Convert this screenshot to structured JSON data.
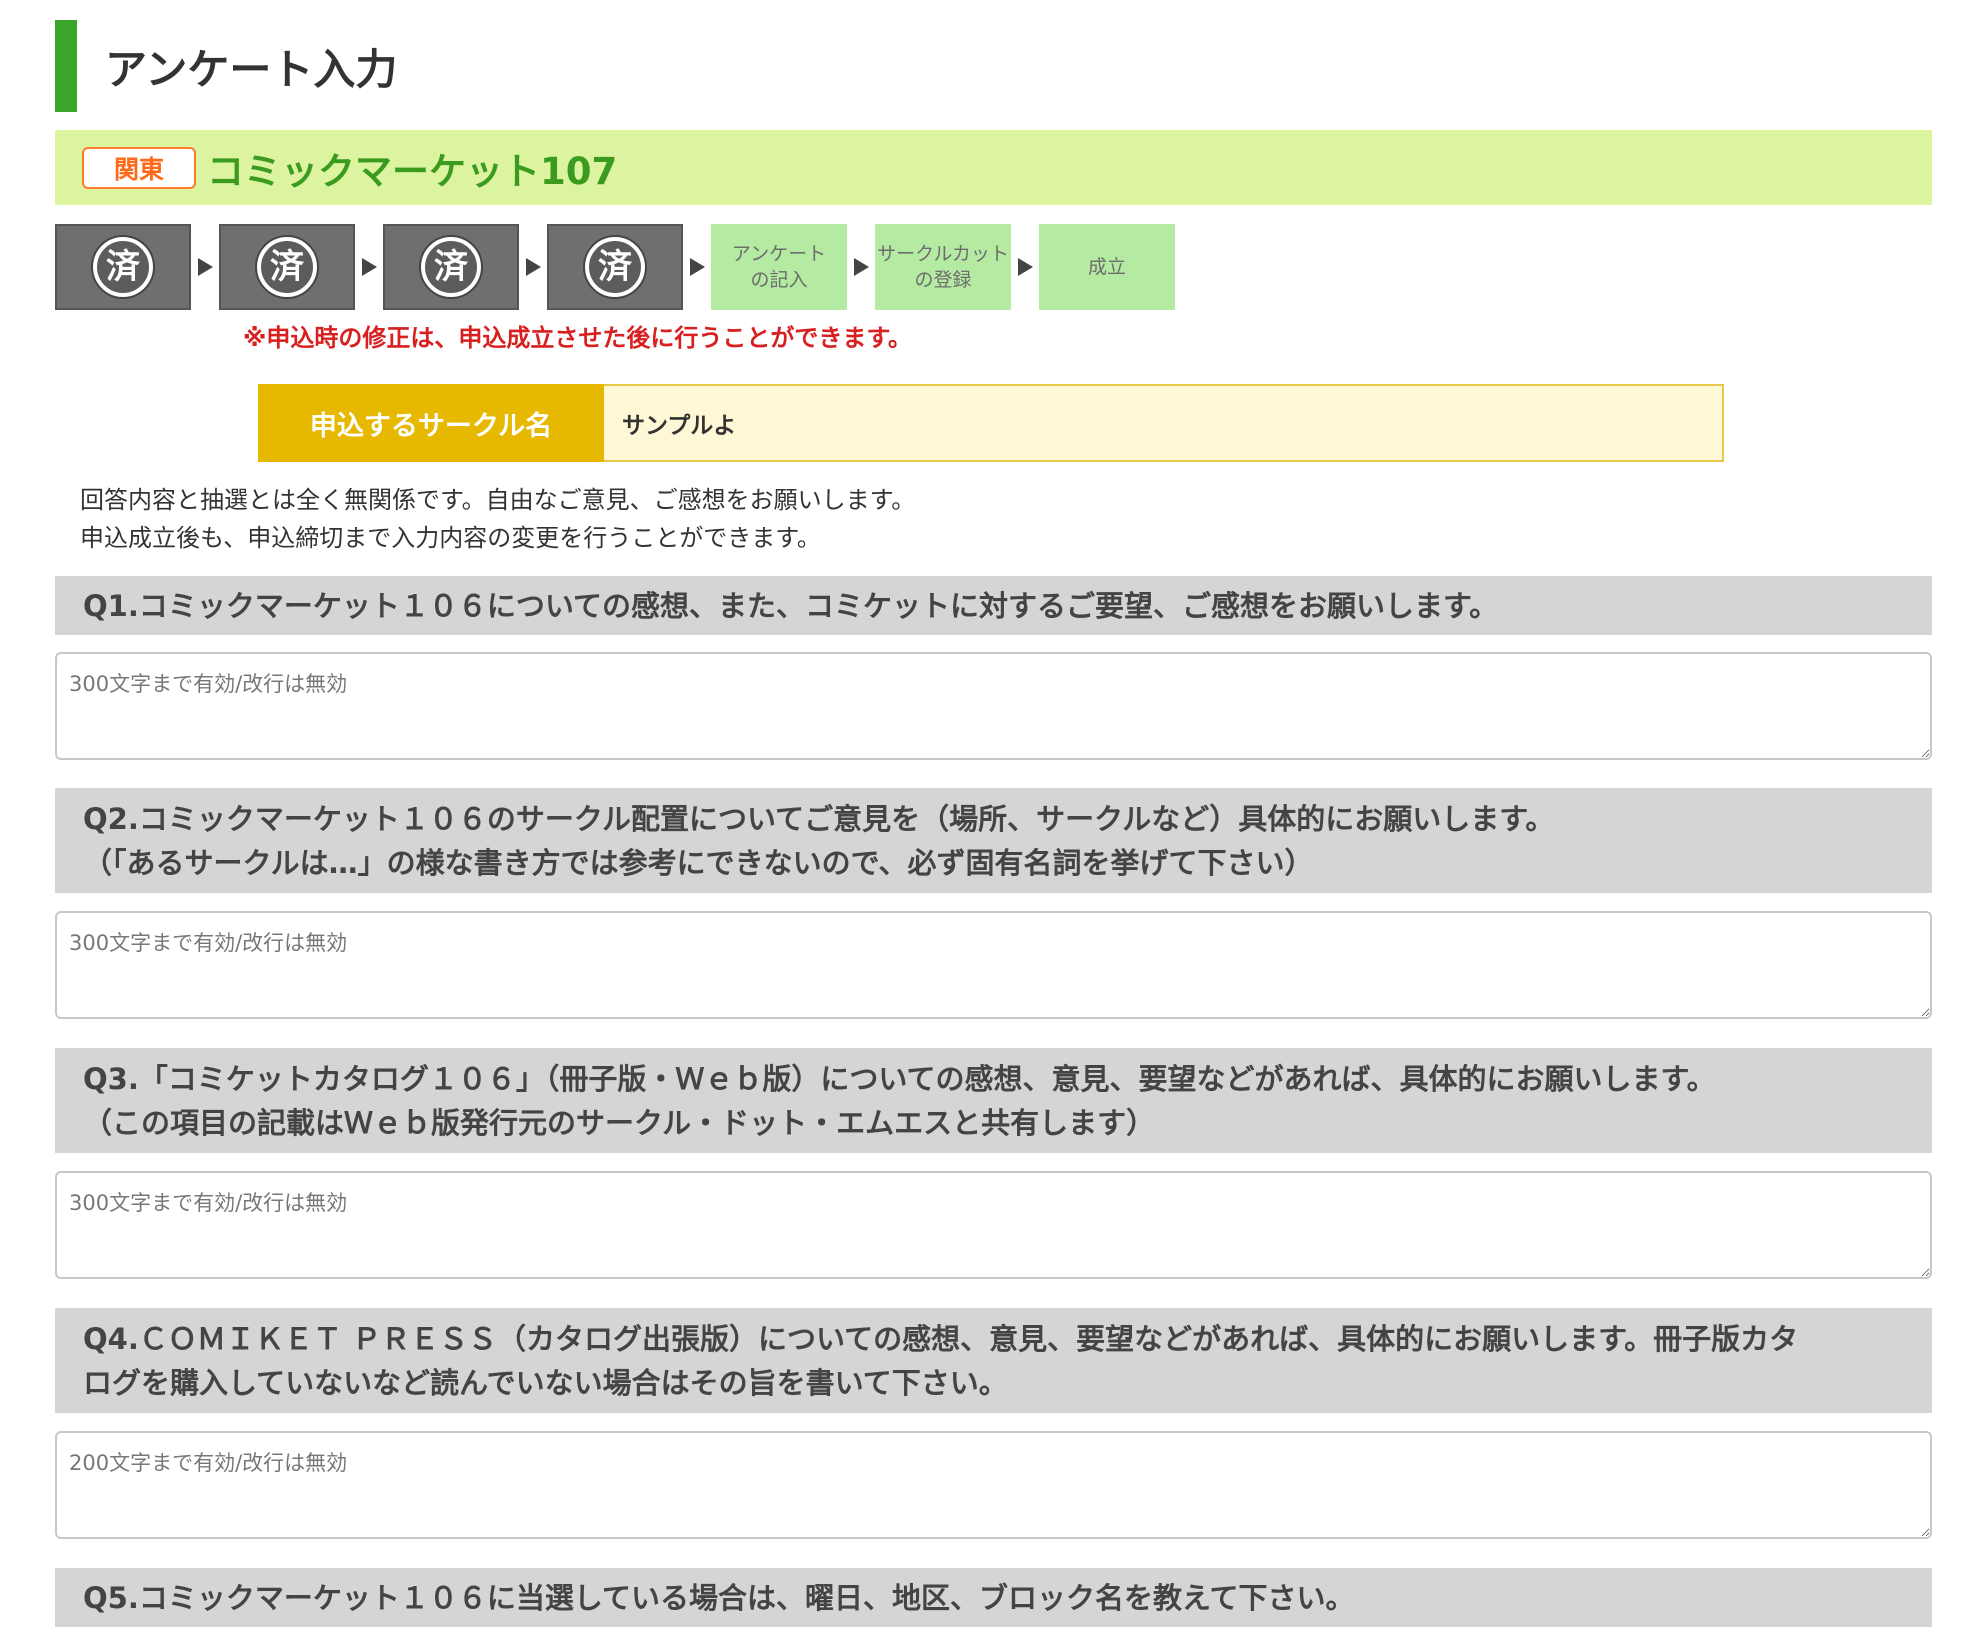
{
  "page": {
    "title": "アンケート入力"
  },
  "event": {
    "region": "関東",
    "name": "コミックマーケット107"
  },
  "steps": [
    {
      "status": "done",
      "mark": "済"
    },
    {
      "status": "done",
      "mark": "済"
    },
    {
      "status": "done",
      "mark": "済"
    },
    {
      "status": "done",
      "mark": "済"
    },
    {
      "status": "todo",
      "line1": "アンケート",
      "line2": "の記入"
    },
    {
      "status": "todo",
      "line1": "サークルカット",
      "line2": "の登録"
    },
    {
      "status": "todo",
      "line1": "成立",
      "line2": ""
    }
  ],
  "notice": "※申込時の修正は、申込成立させた後に行うことができます。",
  "circle": {
    "label": "申込するサークル名",
    "value": "サンプルよ"
  },
  "intro": {
    "line1": "回答内容と抽選とは全く無関係です。自由なご意見、ご感想をお願いします。",
    "line2": "申込成立後も、申込締切まで入力内容の変更を行うことができます。"
  },
  "questions": [
    {
      "line1": "Q1.コミックマーケット１０６についての感想、また、コミケットに対するご要望、ご感想をお願いします。",
      "line2": "",
      "placeholder": "300文字まで有効/改行は無効",
      "value": ""
    },
    {
      "line1": "Q2.コミックマーケット１０６のサークル配置についてご意見を（場所、サークルなど）具体的にお願いします。",
      "line2": "（「あるサークルは…」の様な書き方では参考にできないので、必ず固有名詞を挙げて下さい）",
      "placeholder": "300文字まで有効/改行は無効",
      "value": ""
    },
    {
      "line1": "Q3.「コミケットカタログ１０６」（冊子版・Ｗｅｂ版）についての感想、意見、要望などがあれば、具体的にお願いします。",
      "line2": "（この項目の記載はＷｅｂ版発行元のサークル・ドット・エムエスと共有します）",
      "placeholder": "300文字まで有効/改行は無効",
      "value": ""
    },
    {
      "line1": "Q4.ＣＯＭＩＫＥＴ ＰＲＥＳＳ（カタログ出張版）についての感想、意見、要望などがあれば、具体的にお願いします。冊子版カタ",
      "line2": "ログを購入していないなど読んでいない場合はその旨を書いて下さい。",
      "placeholder": "200文字まで有効/改行は無効",
      "value": ""
    },
    {
      "line1": "Q5.コミックマーケット１０６に当選している場合は、曜日、地区、ブロック名を教えて下さい。",
      "line2": ""
    }
  ]
}
